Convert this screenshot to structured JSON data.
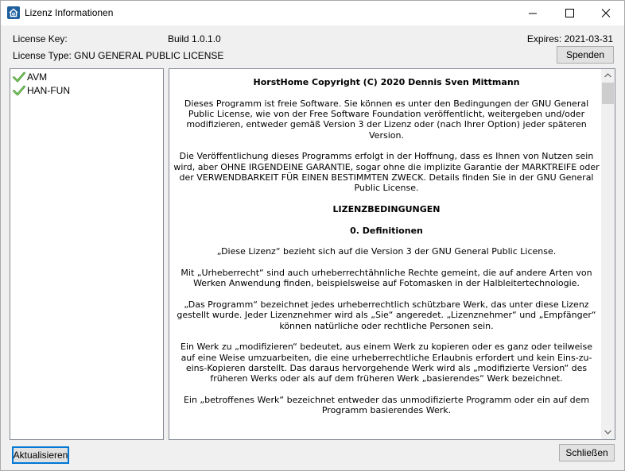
{
  "window": {
    "title": "Lizenz Informationen"
  },
  "header": {
    "license_key_label": "License Key:",
    "build": "Build 1.0.1.0",
    "expires": "Expires: 2021-03-31",
    "license_type": "License Type: GNU GENERAL PUBLIC LICENSE",
    "donate_button": "Spenden"
  },
  "tree": {
    "items": [
      {
        "label": "AVM",
        "icon": "check-icon"
      },
      {
        "label": "HAN-FUN",
        "icon": "check-icon"
      }
    ]
  },
  "license_text": {
    "title": "HorstHome Copyright (C) 2020 Dennis Sven Mittmann",
    "p1": "Dieses Programm ist freie Software. Sie können es unter den Bedingungen der GNU General Public License, wie von der Free Software Foundation veröffentlicht, weitergeben und/oder modifizieren, entweder gemäß Version 3 der Lizenz oder (nach Ihrer Option) jeder späteren Version.",
    "p2": "Die Veröffentlichung dieses Programms erfolgt in der Hoffnung, dass es Ihnen von Nutzen sein wird, aber OHNE IRGENDEINE GARANTIE, sogar ohne die implizite Garantie der MARKTREIFE oder der VERWENDBARKEIT FÜR EINEN BESTIMMTEN ZWECK. Details finden Sie in der GNU General Public License.",
    "heading1": "LIZENZBEDINGUNGEN",
    "heading2": "0. Definitionen",
    "p3": "„Diese Lizenz“ bezieht sich auf die Version 3 der GNU General Public License.",
    "p4": "Mit „Urheberrecht“ sind auch urheberrechtähnliche Rechte gemeint, die auf andere Arten von Werken Anwendung finden, beispielsweise auf Fotomasken in der Halbleitertechnologie.",
    "p5": "„Das Programm“ bezeichnet jedes urheberrechtlich schützbare Werk, das unter diese Lizenz gestellt wurde. Jeder Lizenznehmer wird als „Sie“ angeredet. „Lizenznehmer“ und „Empfänger“ können natürliche oder rechtliche Personen sein.",
    "p6": "Ein Werk zu „modifizieren“ bedeutet, aus einem Werk zu kopieren oder es ganz oder teilweise auf eine Weise umzuarbeiten, die eine urheberrechtliche Erlaubnis erfordert und kein Eins-zu-eins-Kopieren darstellt. Das daraus hervorgehende Werk wird als „modifizierte Version“ des früheren Werks oder als auf dem früheren Werk „basierendes“ Werk bezeichnet.",
    "p7": "Ein „betroffenes Werk“ bezeichnet entweder das unmodifizierte Programm oder ein auf dem Programm basierendes Werk."
  },
  "footer": {
    "refresh_button": "Aktualisieren",
    "close_button": "Schließen"
  },
  "colors": {
    "accent": "#0078d7",
    "check": "#3a8f2a"
  }
}
